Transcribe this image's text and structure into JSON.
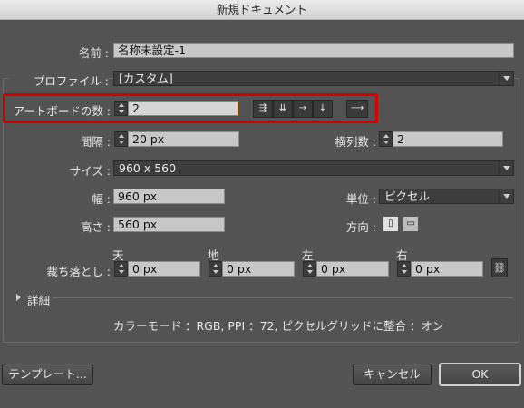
{
  "window": {
    "title": "新規ドキュメント"
  },
  "form": {
    "name_label": "名前 :",
    "name_value": "名称未設定-1",
    "profile_label": "プロファイル :",
    "profile_value": "[カスタム]",
    "artboards_label": "アートボードの数 :",
    "artboards_value": "2",
    "spacing_label": "間隔 :",
    "spacing_value": "20 px",
    "columns_label": "横列数 :",
    "columns_value": "2",
    "size_label": "サイズ :",
    "size_value": "960 x 560",
    "width_label": "幅 :",
    "width_value": "960 px",
    "units_label": "単位 :",
    "units_value": "ピクセル",
    "height_label": "高さ :",
    "height_value": "560 px",
    "orientation_label": "方向 :",
    "bleed_label": "裁ち落とし :",
    "bleed": {
      "top_label": "天",
      "top_value": "0 px",
      "bottom_label": "地",
      "bottom_value": "0 px",
      "left_label": "左",
      "left_value": "0 px",
      "right_label": "右",
      "right_value": "0 px"
    },
    "advanced_label": "詳細",
    "summary": "カラーモード ：RGB, PPI ：72, ピクセルグリッドに整合 ：オン"
  },
  "buttons": {
    "templates": "テンプレート...",
    "cancel": "キャンセル",
    "ok": "OK"
  },
  "icons": {
    "arrange_grid_by_row": "grid-by-row-icon",
    "arrange_grid_by_column": "grid-by-column-icon",
    "arrange_in_row": "arrange-row-icon",
    "arrange_in_column": "arrange-column-icon",
    "direction": "right-arrow-icon",
    "orientation_portrait": "portrait-icon",
    "orientation_landscape": "landscape-icon",
    "link_bleed": "chain-link-icon"
  },
  "colors": {
    "highlight": "#d40000",
    "panel": "#535353"
  }
}
